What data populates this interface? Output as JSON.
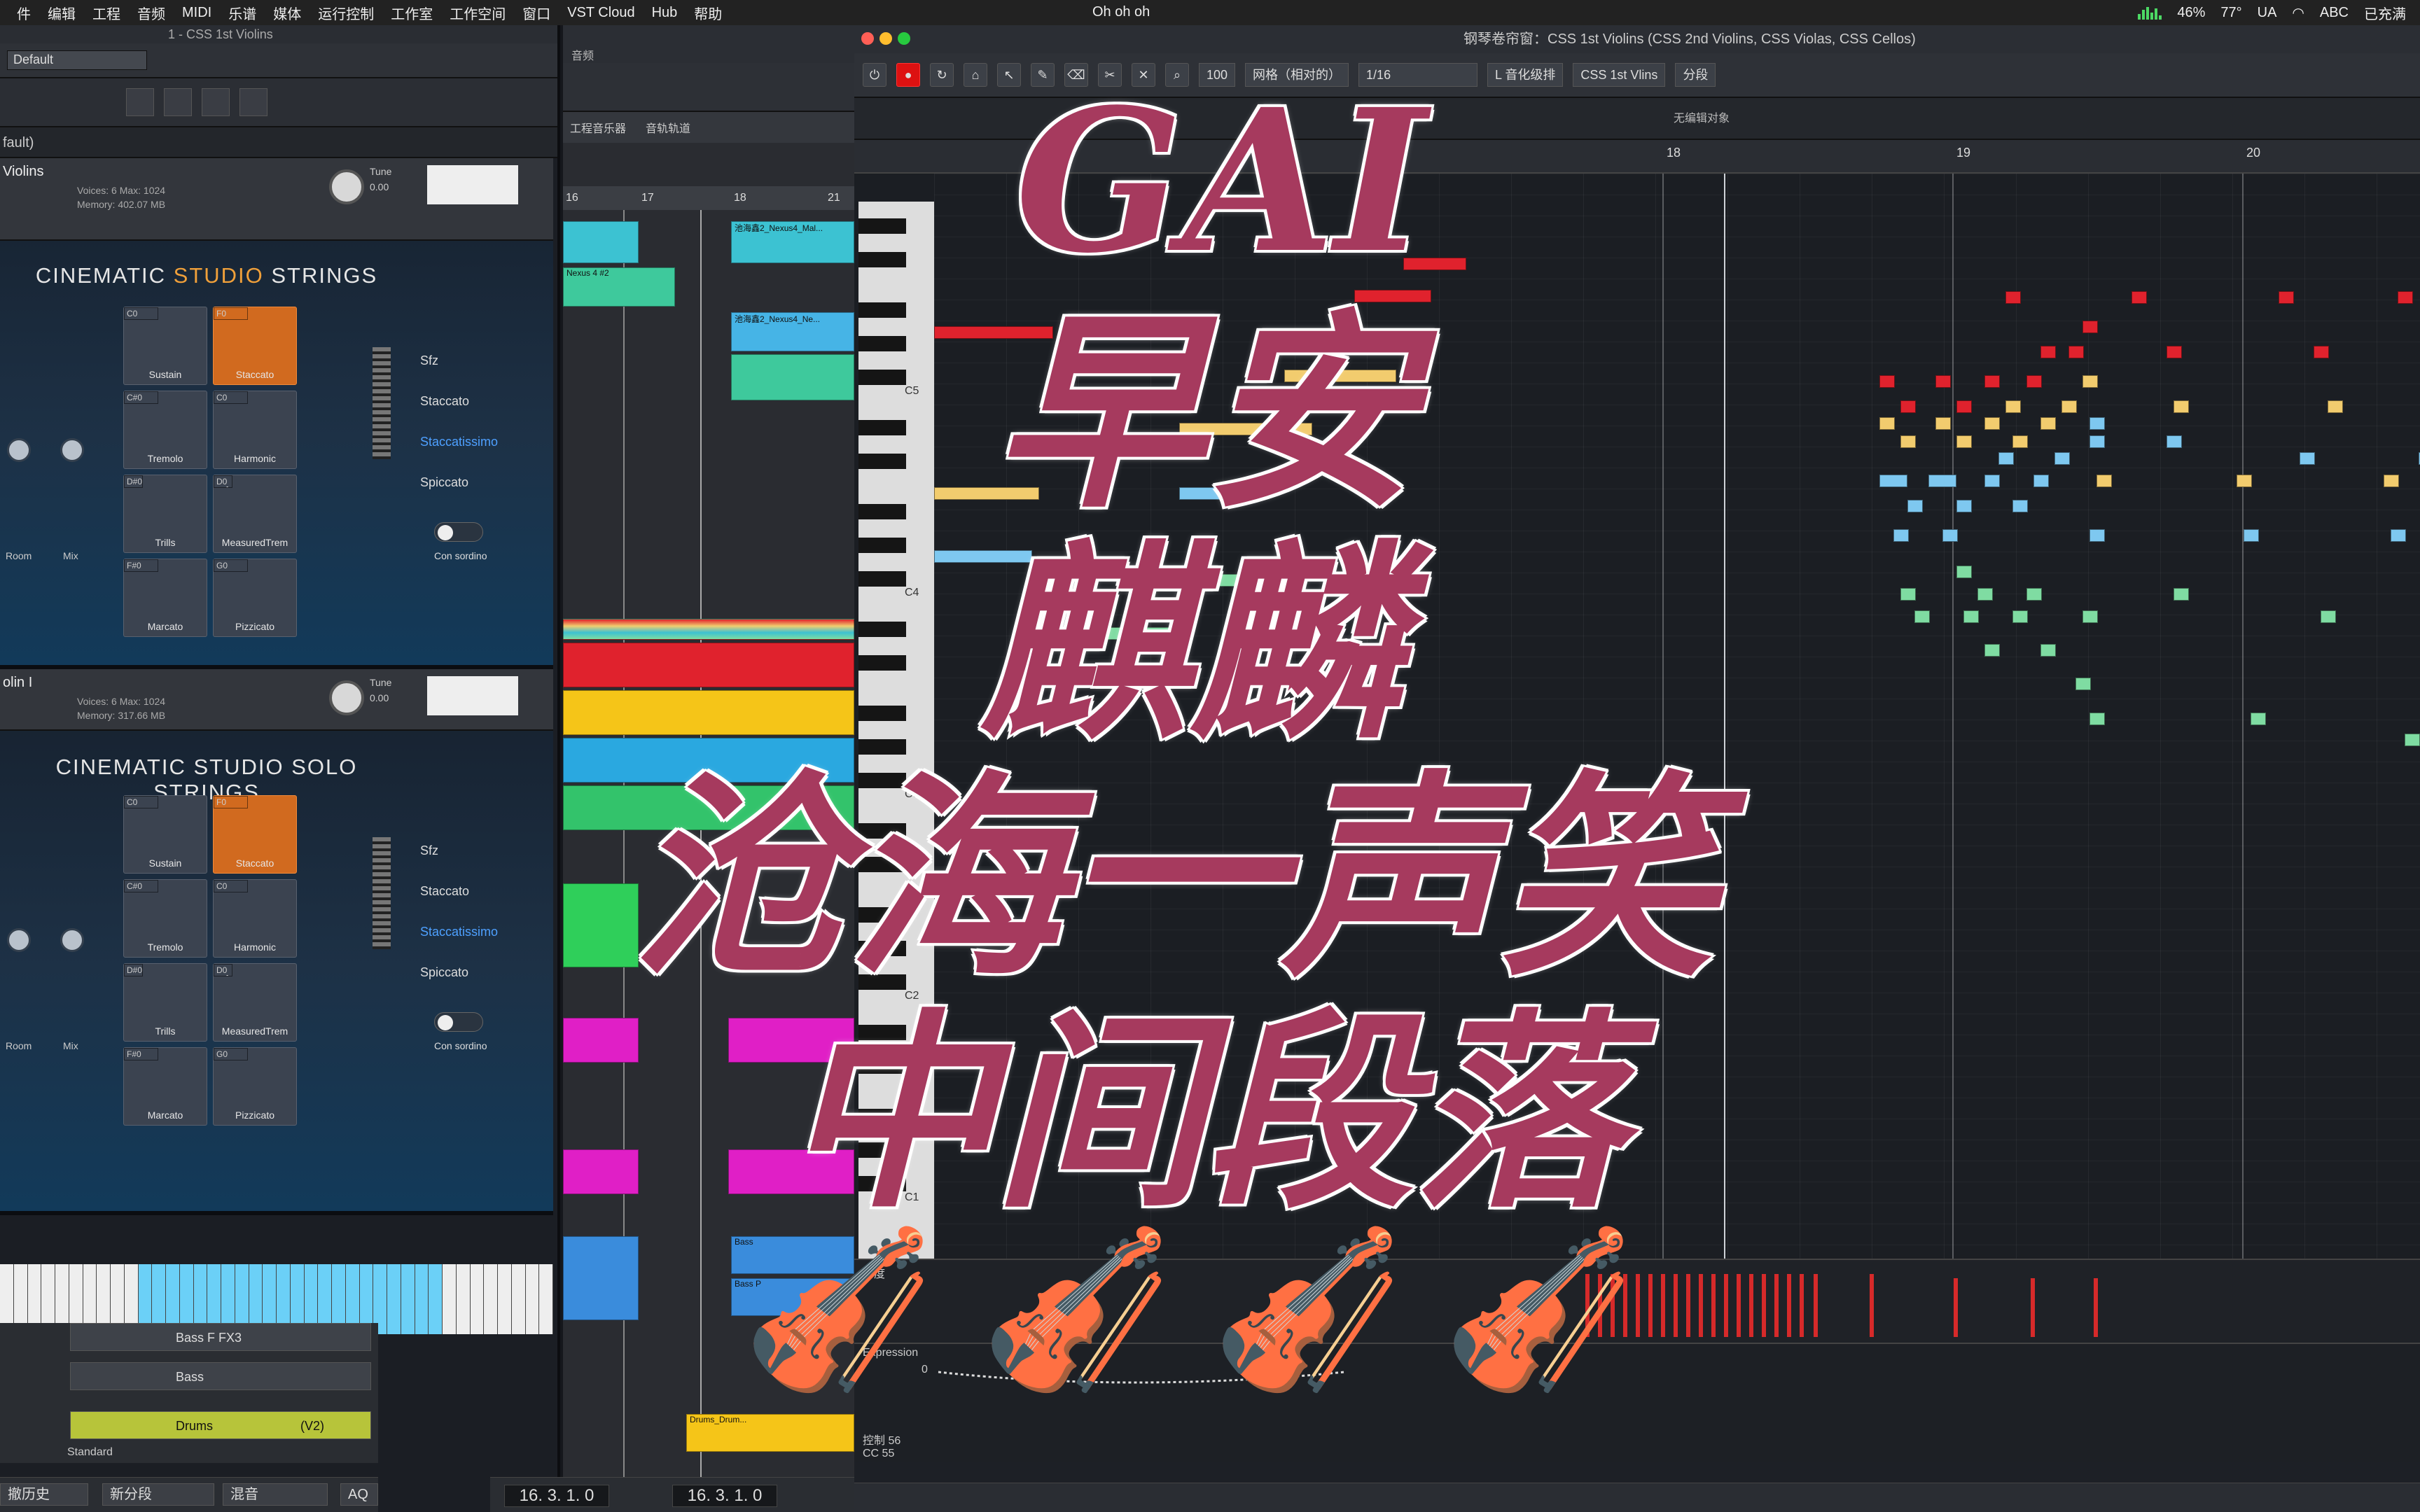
{
  "menubar": {
    "items": [
      "件",
      "编辑",
      "工程",
      "音频",
      "MIDI",
      "乐谱",
      "媒体",
      "运行控制",
      "工作室",
      "工作空间",
      "窗口",
      "VST Cloud",
      "Hub",
      "帮助"
    ],
    "center_title": "Oh oh oh",
    "battery_percent": "46%",
    "temperature": "77°",
    "input_method": "ABC",
    "charge_status": "已充满",
    "ua_label": "UA"
  },
  "kontakt": {
    "window_title": "1 - CSS 1st Violins",
    "preset_field": "Default",
    "rack_label": "fault)",
    "instruments": [
      {
        "name": "Violins",
        "voices": "Voices: 6  Max: 1024",
        "memory": "Memory: 402.07 MB",
        "tune_label": "Tune",
        "tune_value": "0.00",
        "title_pre": "CINEMATIC ",
        "title_hl": "STUDIO",
        "title_post": " STRINGS",
        "articulations": [
          {
            "key": "C0",
            "label": "Sustain",
            "selected": false
          },
          {
            "key": "F0",
            "label": "Staccato",
            "selected": true
          },
          {
            "key": "C#0",
            "label": "Tremolo",
            "selected": false
          },
          {
            "key": "C0",
            "label": "Harmonic",
            "selected": false
          },
          {
            "key": "D#0",
            "label": "Trills",
            "selected": false
          },
          {
            "key": "D0",
            "label": "MeasuredTrem",
            "selected": false
          },
          {
            "key": "F#0",
            "label": "Marcato",
            "selected": false
          },
          {
            "key": "G0",
            "label": "Pizzicato",
            "selected": false
          }
        ],
        "side_list": [
          "Sfz",
          "Staccato",
          "Staccatissimo",
          "Spiccato"
        ],
        "side_highlight": "Staccatissimo",
        "left_labels": [
          "Room",
          "Mix"
        ],
        "toggle_label": "Con sordino"
      },
      {
        "name": "olin I",
        "voices": "Voices: 6  Max: 1024",
        "memory": "Memory: 317.66 MB",
        "tune_label": "Tune",
        "tune_value": "0.00",
        "title_pre": "CINEMATIC STUDIO SOLO STRINGS",
        "title_hl": "",
        "title_post": "",
        "articulations": [
          {
            "key": "C0",
            "label": "Sustain",
            "selected": false
          },
          {
            "key": "F0",
            "label": "Staccato",
            "selected": true
          },
          {
            "key": "C#0",
            "label": "Tremolo",
            "selected": false
          },
          {
            "key": "C0",
            "label": "Harmonic",
            "selected": false
          },
          {
            "key": "D#0",
            "label": "Trills",
            "selected": false
          },
          {
            "key": "D0",
            "label": "MeasuredTrem",
            "selected": false
          },
          {
            "key": "F#0",
            "label": "Marcato",
            "selected": false
          },
          {
            "key": "G0",
            "label": "Pizzicato",
            "selected": false
          }
        ],
        "side_list": [
          "Sfz",
          "Staccato",
          "Staccatissimo",
          "Spiccato"
        ],
        "side_highlight": "Staccatissimo",
        "left_labels": [
          "Room",
          "Mix"
        ],
        "toggle_label": "Con sordino"
      }
    ],
    "tracks": [
      {
        "name": "Bass F FX3",
        "color": "#3a3e45"
      },
      {
        "name": "Bass",
        "color": "#3a3e45"
      },
      {
        "name": "Drums",
        "color": "#b7c43a",
        "version": "(V2)"
      }
    ],
    "standard_label": "Standard",
    "bottom_history": "撤历史",
    "bottom_segment": "新分段",
    "bottom_mix": "混音",
    "bottom_aq": "AQ"
  },
  "arrange": {
    "tabs": [
      "工程音乐器",
      "音轨轨道"
    ],
    "ruler": [
      "16",
      "17",
      "18",
      "21"
    ],
    "tab_header": "音频",
    "clip_labels": [
      "池海鑫2_Nexus4_Mal...",
      "Nexus 4 #2",
      "池海鑫2_Nexus4_Ne...",
      "Bass",
      "Bass P",
      "Drums_Drum..."
    ]
  },
  "editor": {
    "title": "钢琴卷帘窗：CSS 1st Violins (CSS 2nd Violins, CSS Violas, CSS Cellos)",
    "zoom_value": "100",
    "quantize_mode": "网格（相对的）",
    "quantize_value": "1/16",
    "legato_label": "L 音化级排",
    "track_select": "CSS 1st Vlins",
    "segment_label": "分段",
    "info_text": "无编辑对象",
    "ruler": [
      "18",
      "19",
      "20"
    ],
    "key_labels": [
      "C5",
      "C4",
      "C3",
      "C2",
      "C1"
    ],
    "velocity_label": "力度",
    "cc_label": "Expression",
    "cc_value": "0",
    "cc_bottom_label": "控制 56\nCC 55"
  },
  "transport": {
    "left_position": "16. 3. 1.  0",
    "right_position": "16. 3. 1.  0"
  },
  "overlay": {
    "line1": "GAI",
    "line2": "早安",
    "line3": "麒麟",
    "line4": "沧海一声笑",
    "line5": "中间段落",
    "emoji": "🎻"
  },
  "colors": {
    "title_fill": "#a63a5e",
    "title_stroke": "#ffffff",
    "accent_orange": "#d16a1f",
    "note_red": "#e0222d",
    "note_yellow": "#f2cc6e",
    "note_blue": "#7ec8f0",
    "note_green": "#7fdca2"
  }
}
